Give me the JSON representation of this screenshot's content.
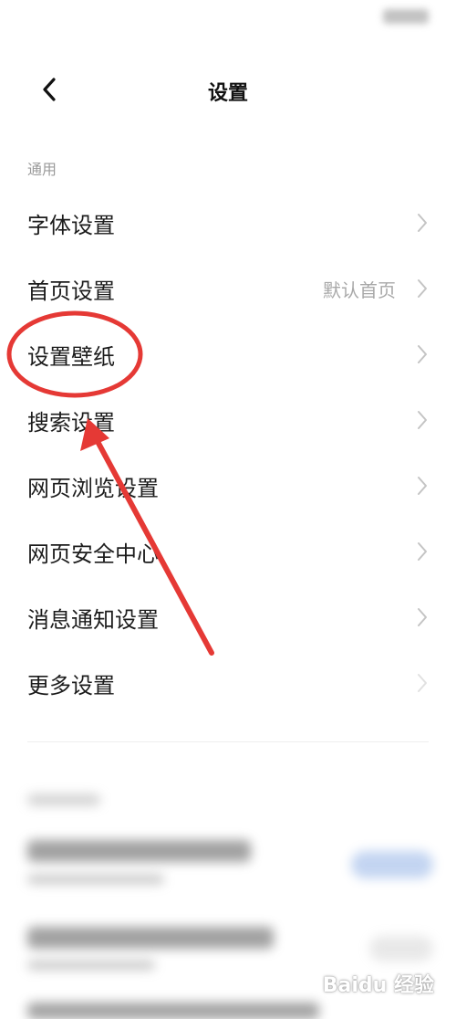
{
  "header": {
    "title": "设置"
  },
  "section": {
    "label": "通用"
  },
  "items": [
    {
      "label": "字体设置",
      "value": ""
    },
    {
      "label": "首页设置",
      "value": "默认首页"
    },
    {
      "label": "设置壁纸",
      "value": ""
    },
    {
      "label": "搜索设置",
      "value": ""
    },
    {
      "label": "网页浏览设置",
      "value": ""
    },
    {
      "label": "网页安全中心",
      "value": ""
    },
    {
      "label": "消息通知设置",
      "value": ""
    },
    {
      "label": "更多设置",
      "value": ""
    }
  ],
  "annotation": {
    "color": "#e53935",
    "highlighted_item": "设置壁纸"
  },
  "watermark": {
    "text": "Baidu 经验"
  }
}
